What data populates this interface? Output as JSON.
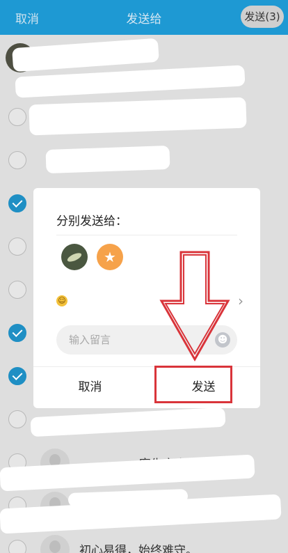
{
  "header": {
    "cancel": "取消",
    "title": "发送给",
    "send": "发送(3)"
  },
  "list": {
    "rows": [
      {
        "checked": false,
        "text": ""
      },
      {
        "checked": false,
        "text": ""
      },
      {
        "checked": false,
        "text": ""
      },
      {
        "checked": true,
        "text": ""
      },
      {
        "checked": false,
        "text": ""
      },
      {
        "checked": false,
        "text": ""
      },
      {
        "checked": true,
        "text": ""
      },
      {
        "checked": true,
        "text": ""
      },
      {
        "checked": false,
        "text": ""
      },
      {
        "checked": false,
        "text": "客生产小组"
      },
      {
        "checked": false,
        "text": "(黑"
      },
      {
        "checked": false,
        "text": "初心易得，始终难守。"
      }
    ]
  },
  "dialog": {
    "title": "分别发送给：",
    "message_placeholder": "输入留言",
    "cancel": "取消",
    "send": "发送"
  },
  "colors": {
    "header_bg": "#1e99d3",
    "check": "#1f8fc4",
    "annotation": "#d9343a"
  },
  "icons": [
    "check-icon",
    "star-icon",
    "emoji-icon",
    "chevron-right-icon",
    "smiley-icon",
    "arrow-down-annotation"
  ]
}
